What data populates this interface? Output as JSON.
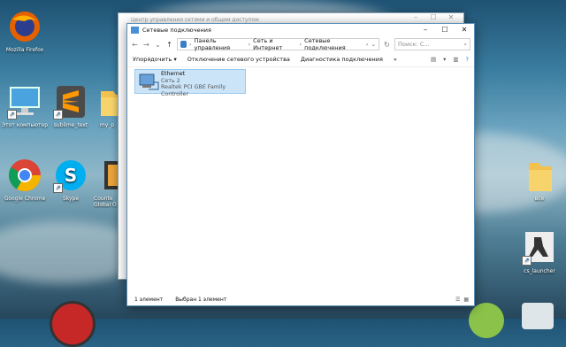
{
  "desktop": {
    "icons": [
      {
        "label": "Mozilla Firefox",
        "icon": "firefox-icon"
      },
      {
        "label": "Этот компьютер",
        "icon": "computer-icon"
      },
      {
        "label": "sublime_text",
        "icon": "sublime-icon"
      },
      {
        "label": "my_p",
        "icon": "folder-icon"
      },
      {
        "label": "Google Chrome",
        "icon": "chrome-icon"
      },
      {
        "label": "Skype",
        "icon": "skype-icon"
      },
      {
        "label": "Counte Global O",
        "icon": "csgo-icon"
      },
      {
        "label": "все",
        "icon": "folder-icon"
      },
      {
        "label": "cs_launcher",
        "icon": "cs-launcher-icon"
      }
    ]
  },
  "back_window": {
    "title": "Центр управления сетями и общим доступом"
  },
  "window": {
    "title": "Сетевые подключения",
    "breadcrumb": [
      "Панель управления",
      "Сеть и Интернет",
      "Сетевые подключения"
    ],
    "search_placeholder": "Поиск: С...",
    "commands": [
      "Упорядочить ▾",
      "Отключение сетевого устройства",
      "Диагностика подключения",
      "»"
    ],
    "item": {
      "name": "Ethernet",
      "network": "Сеть 2",
      "adapter": "Realtek PCI GBE Family Controller"
    },
    "status": {
      "count": "1 элемент",
      "selected": "Выбран 1 элемент"
    }
  },
  "colors": {
    "selection": "#cce4f7",
    "accent": "#0078d7"
  }
}
